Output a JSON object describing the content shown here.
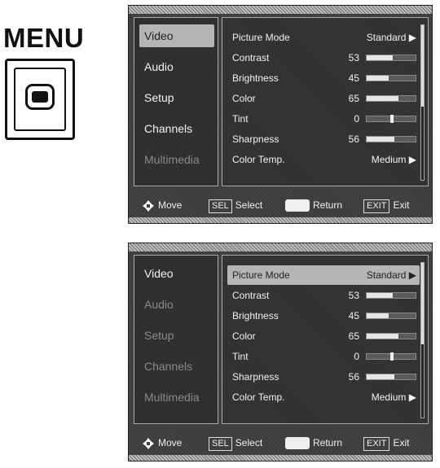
{
  "menu_key": {
    "label": "MENU"
  },
  "screens": [
    {
      "categories": [
        {
          "label": "Video",
          "state": "selected"
        },
        {
          "label": "Audio",
          "state": "active"
        },
        {
          "label": "Setup",
          "state": "active"
        },
        {
          "label": "Channels",
          "state": "active"
        },
        {
          "label": "Multimedia",
          "state": "dim"
        }
      ],
      "settings": [
        {
          "label": "Picture Mode",
          "text": "Standard ▶",
          "selected": false
        },
        {
          "label": "Contrast",
          "value": "53",
          "level": 0.53
        },
        {
          "label": "Brightness",
          "value": "45",
          "level": 0.45
        },
        {
          "label": "Color",
          "value": "65",
          "level": 0.65
        },
        {
          "label": "Tint",
          "value": "0",
          "center": true
        },
        {
          "label": "Sharpness",
          "value": "56",
          "level": 0.56
        },
        {
          "label": "Color Temp.",
          "text": "Medium ▶"
        }
      ]
    },
    {
      "categories": [
        {
          "label": "Video",
          "state": "active"
        },
        {
          "label": "Audio",
          "state": "dim"
        },
        {
          "label": "Setup",
          "state": "dim"
        },
        {
          "label": "Channels",
          "state": "dim"
        },
        {
          "label": "Multimedia",
          "state": "dim"
        }
      ],
      "settings": [
        {
          "label": "Picture Mode",
          "text": "Standard ▶",
          "selected": true
        },
        {
          "label": "Contrast",
          "value": "53",
          "level": 0.53
        },
        {
          "label": "Brightness",
          "value": "45",
          "level": 0.45
        },
        {
          "label": "Color",
          "value": "65",
          "level": 0.65
        },
        {
          "label": "Tint",
          "value": "0",
          "center": true
        },
        {
          "label": "Sharpness",
          "value": "56",
          "level": 0.56
        },
        {
          "label": "Color Temp.",
          "text": "Medium ▶"
        }
      ]
    }
  ],
  "footer": {
    "move": "Move",
    "sel_key": "SEL",
    "select": "Select",
    "return": "Return",
    "exit_key": "EXIT",
    "exit": "Exit"
  }
}
